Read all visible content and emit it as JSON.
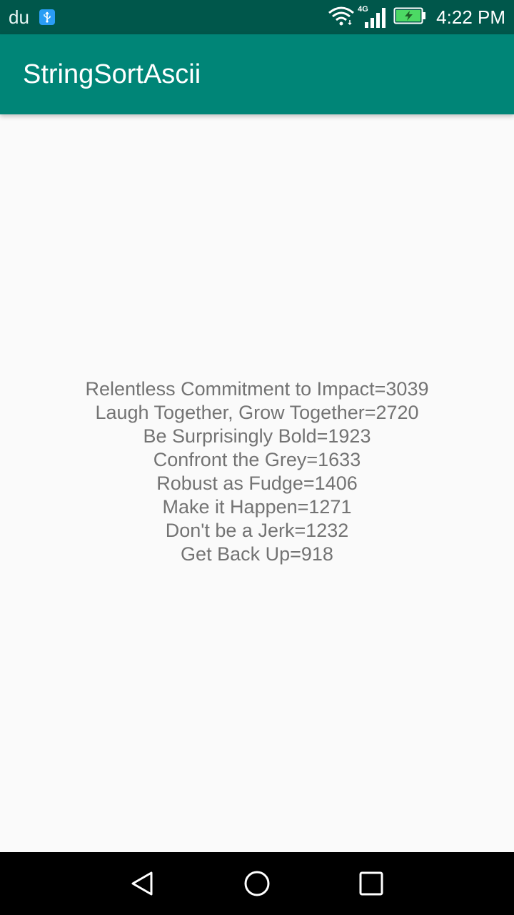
{
  "status_bar": {
    "carrier": "du",
    "network_type": "4G",
    "time": "4:22 PM",
    "icons": [
      "usb-icon",
      "wifi-icon",
      "signal-icon",
      "battery-charging-icon"
    ]
  },
  "app_bar": {
    "title": "StringSortAscii"
  },
  "results": [
    "Relentless Commitment to Impact=3039",
    "Laugh Together, Grow Together=2720",
    "Be Surprisingly Bold=1923",
    "Confront the Grey=1633",
    "Robust as Fudge=1406",
    "Make it Happen=1271",
    "Don't be a Jerk=1232",
    "Get Back Up=918"
  ],
  "nav_bar": {
    "buttons": [
      "back-icon",
      "home-icon",
      "recents-icon"
    ]
  },
  "colors": {
    "status_bar": "#00574b",
    "app_bar": "#008577",
    "background": "#fafafa",
    "text": "#737373"
  }
}
